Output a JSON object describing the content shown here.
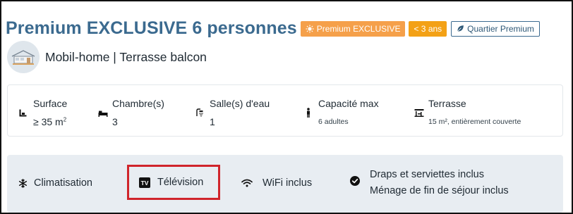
{
  "title": "Premium EXCLUSIVE 6 personnes",
  "badges": {
    "exclusive": "Premium EXCLUSIVE",
    "age": "< 3 ans",
    "quartier": "Quartier Premium"
  },
  "subtitle": "Mobil-home | Terrasse balcon",
  "specs": {
    "surface": {
      "label": "Surface",
      "value": "≥ 35 m",
      "sup": "2"
    },
    "chambres": {
      "label": "Chambre(s)",
      "value": "3"
    },
    "salles": {
      "label": "Salle(s) d'eau",
      "value": "1"
    },
    "capacite": {
      "label": "Capacité max",
      "value": "6 adultes"
    },
    "terrasse": {
      "label": "Terrasse",
      "value": "15 m², entièrement couverte"
    }
  },
  "amenities": {
    "clim": "Climatisation",
    "tv": "Télévision",
    "wifi": "WiFi inclus",
    "draps": "Draps et serviettes inclus",
    "menage": "Ménage de fin de séjour inclus"
  },
  "colors": {
    "brand": "#3b6a8f",
    "exclusive": "#f5a04a",
    "age": "#f3a116",
    "highlight": "#d0242b"
  },
  "icons": {
    "exclusive": "sun-icon",
    "quartier": "leaf-icon",
    "house": "mobile-home-icon",
    "surface": "surface-icon",
    "chambres": "bed-icon",
    "salles": "shower-icon",
    "capacite": "person-icon",
    "terrasse": "terrace-icon",
    "clim": "snowflake-icon",
    "tv": "tv-icon",
    "wifi": "wifi-icon",
    "draps": "check-circle-icon"
  }
}
